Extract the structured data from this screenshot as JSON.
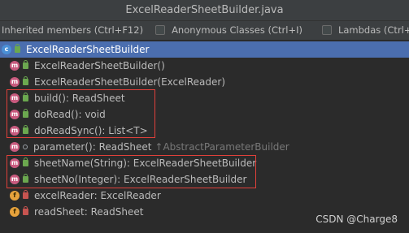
{
  "window": {
    "title": "ExcelReaderSheetBuilder.java"
  },
  "options": {
    "inherited": "Inherited members (Ctrl+F12)",
    "anonymous": "Anonymous Classes (Ctrl+I)",
    "lambdas": "Lambdas (Ctrl+L)"
  },
  "tree": {
    "root": "ExcelReaderSheetBuilder",
    "items": [
      {
        "icon": "method-icon",
        "label": "ExcelReaderSheetBuilder()"
      },
      {
        "icon": "method-icon",
        "label": "ExcelReaderSheetBuilder(ExcelReader)"
      },
      {
        "icon": "method-icon",
        "label": "build(): ReadSheet"
      },
      {
        "icon": "method-icon",
        "label": "doRead(): void"
      },
      {
        "icon": "method-icon",
        "label": "doReadSync(): List<T>"
      },
      {
        "icon": "method-icon",
        "label": "parameter(): ReadSheet",
        "inherited": "↑AbstractParameterBuilder"
      },
      {
        "icon": "method-icon",
        "label": "sheetName(String): ExcelReaderSheetBuilder"
      },
      {
        "icon": "method-icon",
        "label": "sheetNo(Integer): ExcelReaderSheetBuilder"
      },
      {
        "icon": "field-icon",
        "label": "excelReader: ExcelReader"
      },
      {
        "icon": "field-icon",
        "label": "readSheet: ReadSheet"
      }
    ]
  },
  "watermark": "CSDN @Charge8",
  "colors": {
    "selection": "#4b6eaf",
    "highlight_border": "#e0403a",
    "method": "#c85a7e",
    "field": "#e6a23c"
  }
}
